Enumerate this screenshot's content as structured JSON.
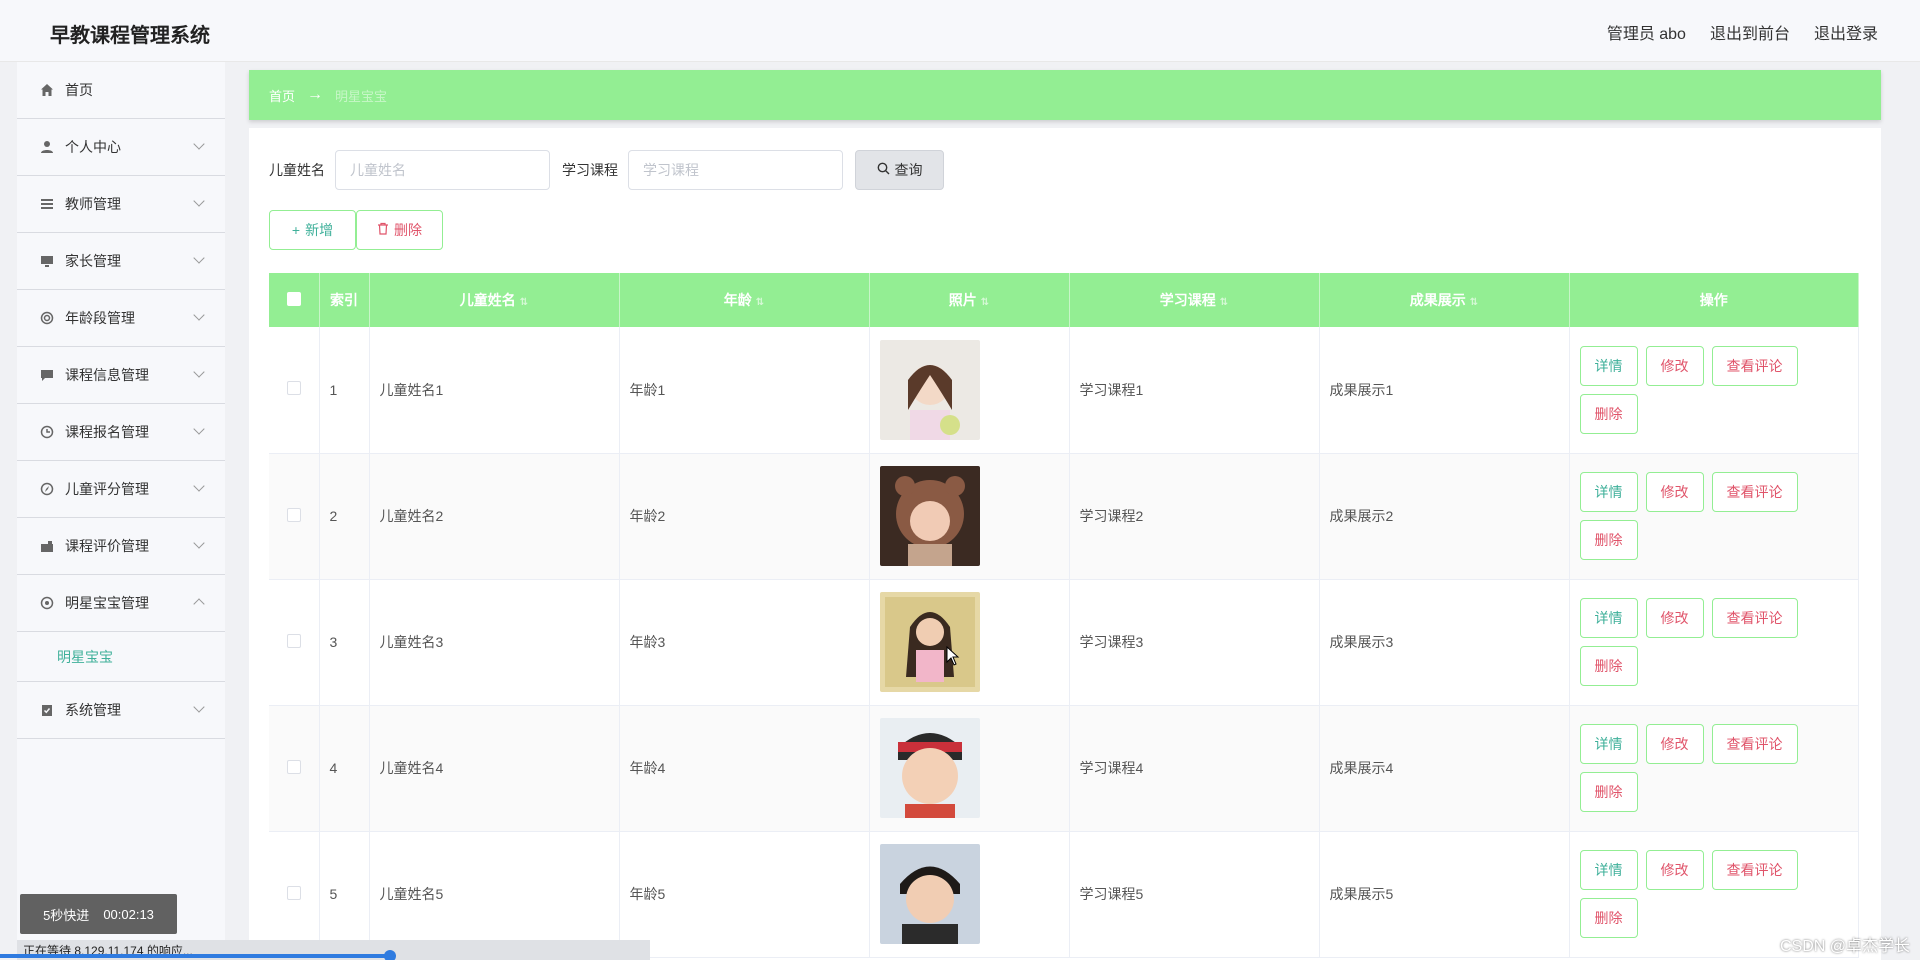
{
  "app": {
    "title": "早教课程管理系统"
  },
  "header": {
    "user": "管理员 abo",
    "to_frontend": "退出到前台",
    "logout": "退出登录"
  },
  "sidebar": {
    "items": [
      {
        "label": "首页",
        "icon": "home-icon"
      },
      {
        "label": "个人中心",
        "icon": "user-icon"
      },
      {
        "label": "教师管理",
        "icon": "list-icon"
      },
      {
        "label": "家长管理",
        "icon": "monitor-icon"
      },
      {
        "label": "年龄段管理",
        "icon": "lifebuoy-icon"
      },
      {
        "label": "课程信息管理",
        "icon": "chat-icon"
      },
      {
        "label": "课程报名管理",
        "icon": "clock-icon"
      },
      {
        "label": "儿童评分管理",
        "icon": "compass-icon"
      },
      {
        "label": "课程评价管理",
        "icon": "briefcase-icon"
      },
      {
        "label": "明星宝宝管理",
        "icon": "chrome-icon"
      },
      {
        "label": "系统管理",
        "icon": "clipboard-icon"
      }
    ],
    "subitem": "明星宝宝"
  },
  "breadcrumb": {
    "home": "首页",
    "current": "明星宝宝"
  },
  "search": {
    "name_label": "儿童姓名",
    "name_placeholder": "儿童姓名",
    "course_label": "学习课程",
    "course_placeholder": "学习课程",
    "button": "查询"
  },
  "actions": {
    "add": "新增",
    "delete": "删除"
  },
  "table": {
    "headers": [
      "索引",
      "儿童姓名",
      "年龄",
      "照片",
      "学习课程",
      "成果展示",
      "操作"
    ],
    "ops": {
      "detail": "详情",
      "edit": "修改",
      "review": "查看评论",
      "delete": "删除"
    },
    "rows": [
      {
        "index": "1",
        "name": "儿童姓名1",
        "age": "年龄1",
        "course": "学习课程1",
        "result": "成果展示1"
      },
      {
        "index": "2",
        "name": "儿童姓名2",
        "age": "年龄2",
        "course": "学习课程2",
        "result": "成果展示2"
      },
      {
        "index": "3",
        "name": "儿童姓名3",
        "age": "年龄3",
        "course": "学习课程3",
        "result": "成果展示3"
      },
      {
        "index": "4",
        "name": "儿童姓名4",
        "age": "年龄4",
        "course": "学习课程4",
        "result": "成果展示4"
      },
      {
        "index": "5",
        "name": "儿童姓名5",
        "age": "年龄5",
        "course": "学习课程5",
        "result": "成果展示5"
      }
    ]
  },
  "overlay": {
    "video_label": "5秒快进",
    "video_time": "00:02:13",
    "status": "正在等待 8.129.11.174 的响应...",
    "watermark": "CSDN @卓杰学长"
  },
  "colors": {
    "accent": "#93ee93",
    "link": "#3fb09a",
    "danger": "#e0546a"
  }
}
